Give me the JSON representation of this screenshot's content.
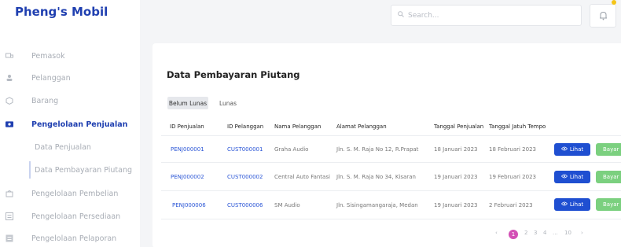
{
  "app": {
    "brand": "Pheng's Mobil"
  },
  "search": {
    "placeholder": "Search..."
  },
  "sidebar": {
    "items": [
      {
        "label": "Pemasok",
        "icon": "truck-icon"
      },
      {
        "label": "Pelanggan",
        "icon": "user-icon"
      },
      {
        "label": "Barang",
        "icon": "box-icon"
      },
      {
        "label": "Pengelolaan Penjualan",
        "icon": "wallet-icon",
        "active": true
      },
      {
        "label": "Data Penjualan"
      },
      {
        "label": "Data Pembayaran Piutang",
        "selected": true
      },
      {
        "label": "Pengelolaan Pembelian",
        "icon": "cart-icon"
      },
      {
        "label": "Pengelolaan Persediaan",
        "icon": "list-icon"
      },
      {
        "label": "Pengelolaan Pelaporan",
        "icon": "report-icon"
      }
    ]
  },
  "main": {
    "title": "Data Pembayaran Piutang",
    "tabs": [
      {
        "label": "Belum Lunas",
        "active": true
      },
      {
        "label": "Lunas",
        "active": false
      }
    ],
    "columns": [
      "ID Penjualan",
      "ID Pelanggan",
      "Nama Pelanggan",
      "Alamat Pelanggan",
      "Tanggal Penjualan",
      "Tanggal Jatuh Tempo"
    ],
    "rows": [
      {
        "id_penjualan": "PENJ000001",
        "id_pelanggan": "CUST000001",
        "nama": "Graha Audio",
        "alamat": "Jln. S. M. Raja No 12, R.Prapat",
        "tgl_penjualan": "18 Januari 2023",
        "tgl_jatuh_tempo": "18 Februari 2023"
      },
      {
        "id_penjualan": "PENJ000002",
        "id_pelanggan": "CUST000002",
        "nama": "Central Auto Fantasi",
        "alamat": "Jln. S. M. Raja No 34, Kisaran",
        "tgl_penjualan": "19 Januari 2023",
        "tgl_jatuh_tempo": "19 Februari 2023"
      },
      {
        "id_penjualan": "PENJ000006",
        "id_pelanggan": "CUST000006",
        "nama": "SM Audio",
        "alamat": "Jln. Sisingamangaraja, Medan",
        "tgl_penjualan": "19 Januari 2023",
        "tgl_jatuh_tempo": "2 Februari 2023"
      }
    ],
    "actions": {
      "view_label": "Lihat",
      "pay_label": "Bayar"
    }
  },
  "pagination": {
    "prev": "‹",
    "pages": [
      "1",
      "2",
      "3",
      "4",
      "...",
      "10"
    ],
    "next": "›",
    "current": "1"
  },
  "colors": {
    "brand": "#1f3fb0",
    "view": "#1f4fd1",
    "pay": "#7bd07f",
    "page_active": "#d34fb5",
    "notification": "#f5c518"
  }
}
